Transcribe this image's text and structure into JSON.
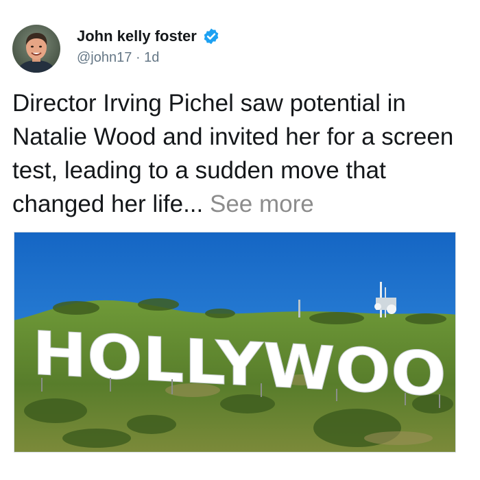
{
  "author": {
    "name": "John kelly foster",
    "handle": "@john17",
    "separator": "·",
    "age": "1d",
    "verified": true,
    "avatar_icon": "person-avatar"
  },
  "post": {
    "text": "Director Irving Pichel saw potential in Natalie Wood and invited her for a screen test, leading to a sudden move that changed her life...",
    "see_more": "See more"
  },
  "image": {
    "sign_text": "HOLLYWOO"
  },
  "colors": {
    "verified_blue": "#1da1f2",
    "handle_gray": "#657786",
    "see_more_gray": "#8c8c8c",
    "sky_blue": "#1d7fd6",
    "hill_green": "#5f8a2e"
  }
}
